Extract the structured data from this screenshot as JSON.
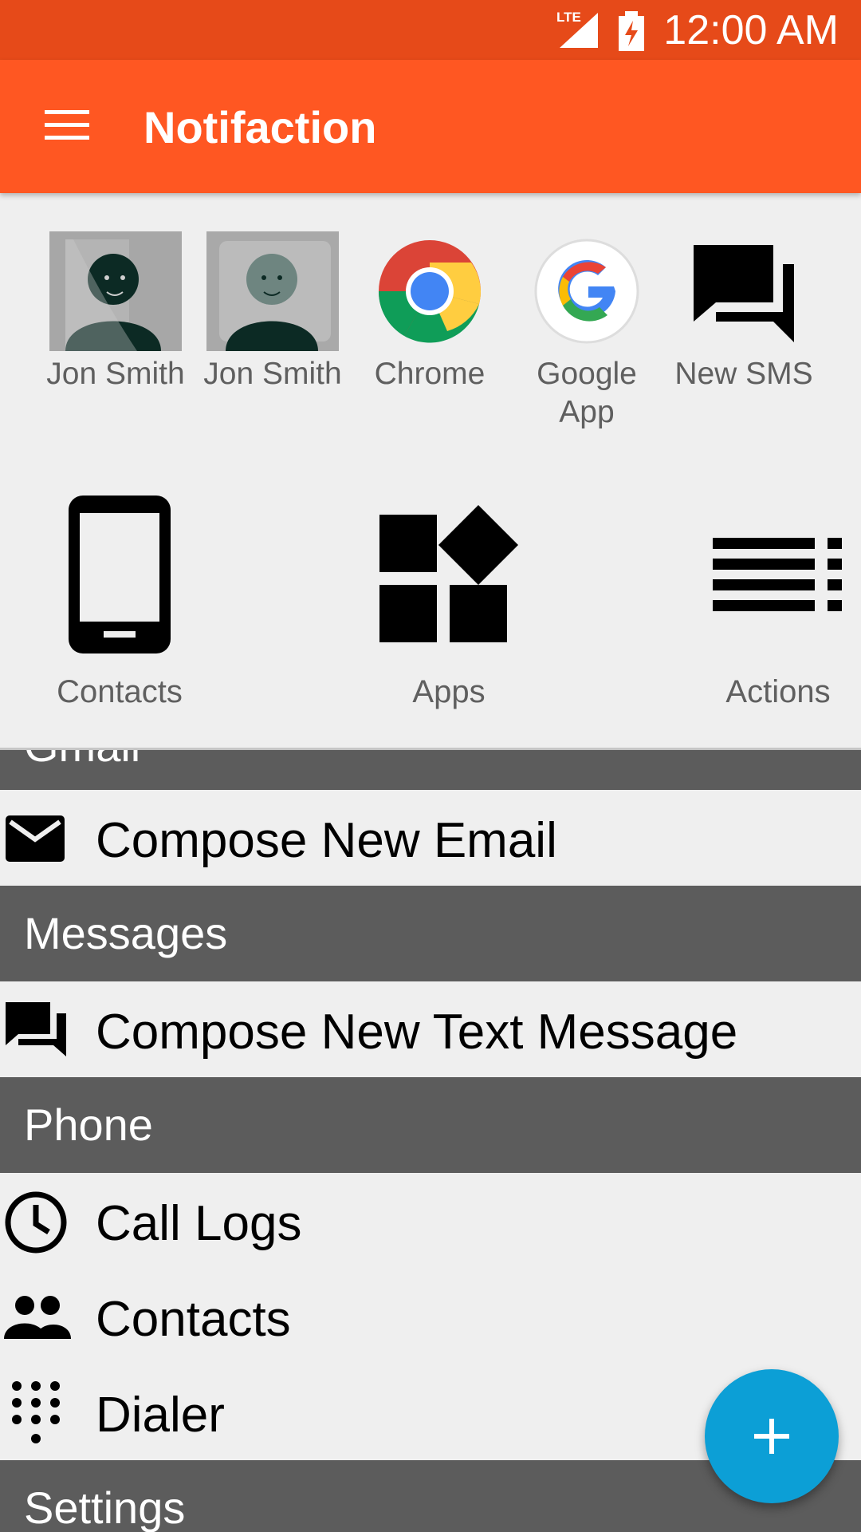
{
  "status_bar": {
    "network": "LTE",
    "time": "12:00 AM"
  },
  "app_bar": {
    "title": "Notifaction",
    "menu_icon": "menu-icon"
  },
  "favorites": [
    {
      "label": "Jon Smith",
      "icon": "contact-avatar"
    },
    {
      "label": "Jon Smith",
      "icon": "contact-avatar"
    },
    {
      "label": "Chrome",
      "icon": "chrome-icon"
    },
    {
      "label": "Google App",
      "icon": "google-icon"
    },
    {
      "label": "New SMS",
      "icon": "chat-icon"
    }
  ],
  "categories": [
    {
      "label": "Contacts",
      "icon": "phone-icon"
    },
    {
      "label": "Apps",
      "icon": "apps-icon"
    },
    {
      "label": "Actions",
      "icon": "list-icon"
    }
  ],
  "list": {
    "email_header": "Gmail",
    "compose_email": "Compose New Email",
    "messages_header": "Messages",
    "compose_text": "Compose New Text Message",
    "phone_header": "Phone",
    "call_logs": "Call Logs",
    "contacts": "Contacts",
    "dialer": "Dialer",
    "settings_header": "Settings"
  },
  "fab": {
    "icon": "plus-icon"
  },
  "colors": {
    "status_bar": "#e64a19",
    "app_bar": "#ff5722",
    "section": "#5c5c5c",
    "fab": "#0c9fd6"
  }
}
